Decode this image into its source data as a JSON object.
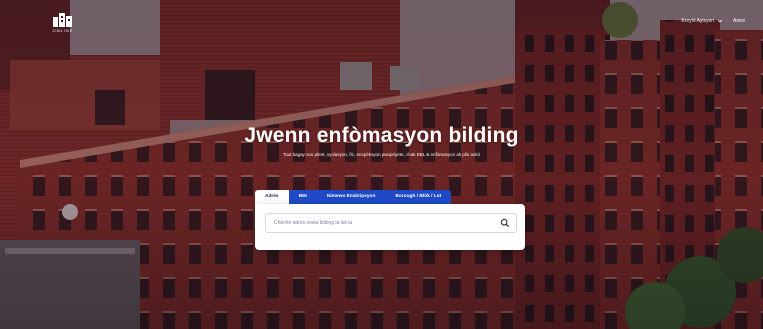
{
  "header": {
    "logo_icon": "building-logo-icon",
    "logo_subtext": "ONLINE",
    "language_label": "Kreyòl Ayisyen",
    "language_icon": "chevron-down-icon",
    "sign_in_label": "Antre"
  },
  "hero": {
    "title": "Jwenn enfòmasyon bilding",
    "subtitle": "Tout bagay sou plent, vyolasyon, fiz, enspèksyon pwopriyete, chak BBL & enfòmasyon ak plis ankò"
  },
  "search": {
    "tabs": [
      {
        "label": "Adrès",
        "active": true
      },
      {
        "label": "BIN",
        "active": false
      },
      {
        "label": "Nimewo Enskripsyon",
        "active": false
      },
      {
        "label": "Borough / Blòk / Lot",
        "active": false
      }
    ],
    "placeholder": "Chèche adrès oswa bilding la isit la",
    "search_icon": "magnifier-icon"
  },
  "colors": {
    "tab_blue": "#1f49c7",
    "brick": "#7a2a26",
    "text_on_hero": "#ffffff"
  }
}
